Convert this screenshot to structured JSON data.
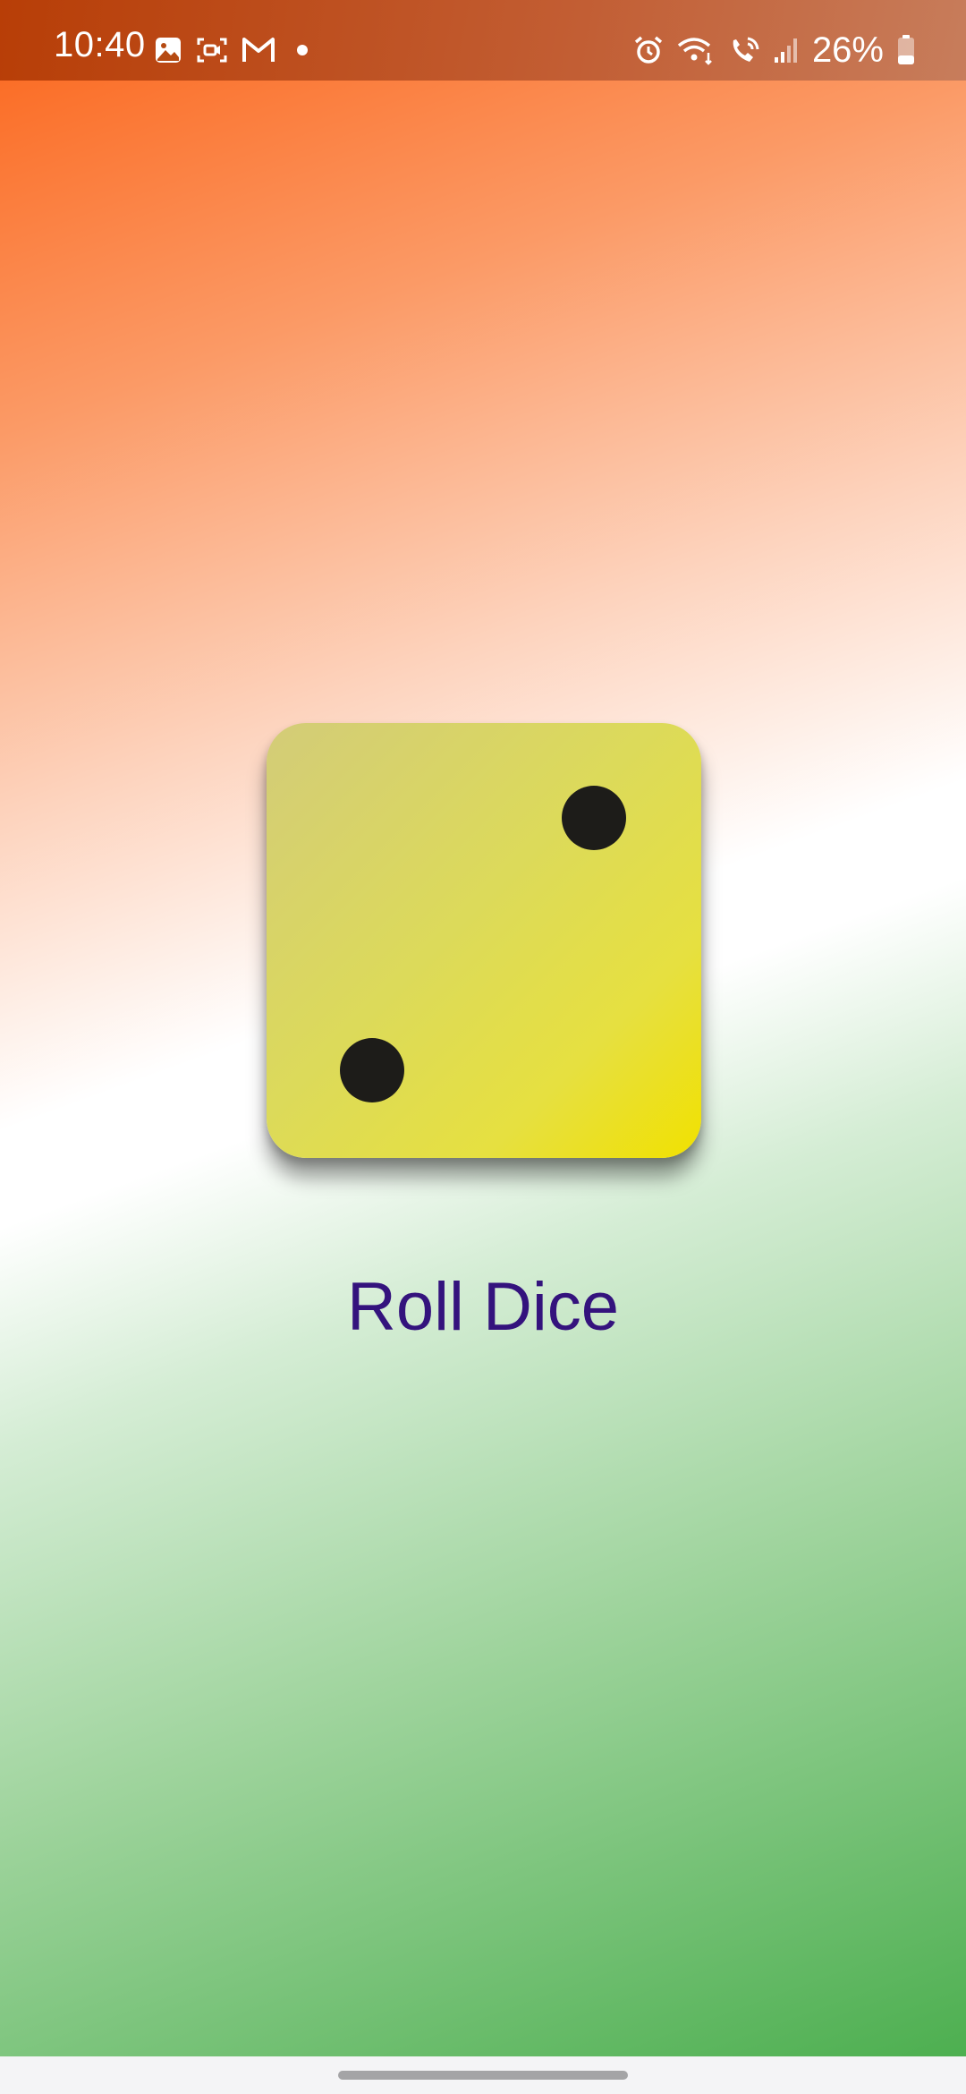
{
  "status_bar": {
    "time": "10:40",
    "left_icons": [
      "gallery-icon",
      "screen-record-icon",
      "gmail-icon",
      "notification-dot-icon"
    ],
    "right_icons": [
      "alarm-icon",
      "wifi-icon",
      "wifi-calling-icon",
      "signal-icon",
      "battery-icon"
    ],
    "battery": "26%"
  },
  "die": {
    "face_value": 2,
    "pip_color": "#1d1c19",
    "face_color": "#e6e040"
  },
  "roll_button": {
    "label": "Roll Dice",
    "color": "#34137d"
  },
  "background": {
    "colors": [
      "#fb6419",
      "#ffffff",
      "#4daf50"
    ]
  }
}
